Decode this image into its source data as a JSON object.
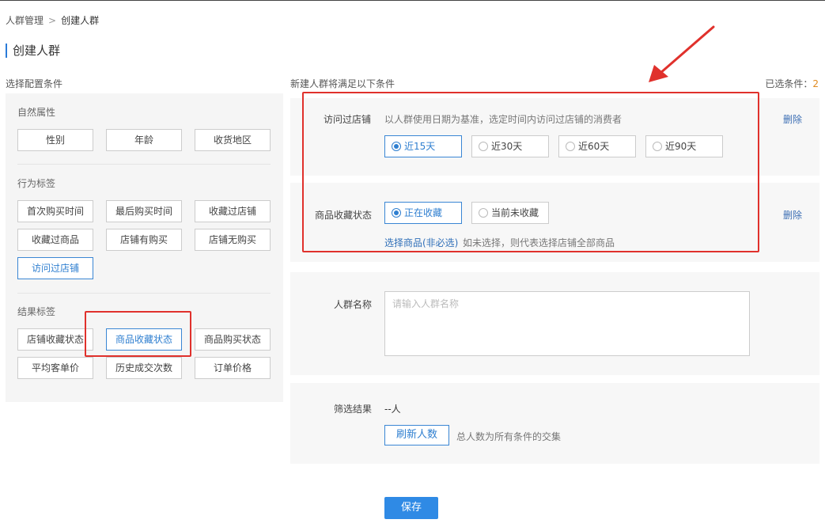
{
  "breadcrumb": {
    "parent": "人群管理",
    "separator": ">",
    "current": "创建人群"
  },
  "page_title": "创建人群",
  "left": {
    "title": "选择配置条件",
    "sections": [
      {
        "label": "自然属性",
        "tags": [
          "性别",
          "年龄",
          "收货地区"
        ]
      },
      {
        "label": "行为标签",
        "tags": [
          "首次购买时间",
          "最后购买时间",
          "收藏过店铺",
          "收藏过商品",
          "店铺有购买",
          "店铺无购买",
          "访问过店铺"
        ]
      },
      {
        "label": "结果标签",
        "tags": [
          "店铺收藏状态",
          "商品收藏状态",
          "商品购买状态",
          "平均客单价",
          "历史成交次数",
          "订单价格"
        ]
      }
    ]
  },
  "conditions": {
    "title": "新建人群将满足以下条件",
    "selected_label": "已选条件：",
    "selected_count": "2",
    "visit": {
      "label": "访问过店铺",
      "desc": "以人群使用日期为基准，选定时间内访问过店铺的消费者",
      "options": [
        "近15天",
        "近30天",
        "近60天",
        "近90天"
      ],
      "selected": "近15天",
      "delete": "删除"
    },
    "fav": {
      "label": "商品收藏状态",
      "options": [
        "正在收藏",
        "当前未收藏"
      ],
      "selected": "正在收藏",
      "link": "选择商品(非必选)",
      "hint": "如未选择，则代表选择店铺全部商品",
      "delete": "删除"
    }
  },
  "name_field": {
    "label": "人群名称",
    "placeholder": "请输入人群名称",
    "value": ""
  },
  "result": {
    "label": "筛选结果",
    "value": "--人",
    "refresh_button": "刷新人数",
    "hint": "总人数为所有条件的交集"
  },
  "save_button": "保存",
  "colors": {
    "accent": "#2f8ae5",
    "annotation_red": "#e0312c",
    "count": "#e08a1e"
  }
}
